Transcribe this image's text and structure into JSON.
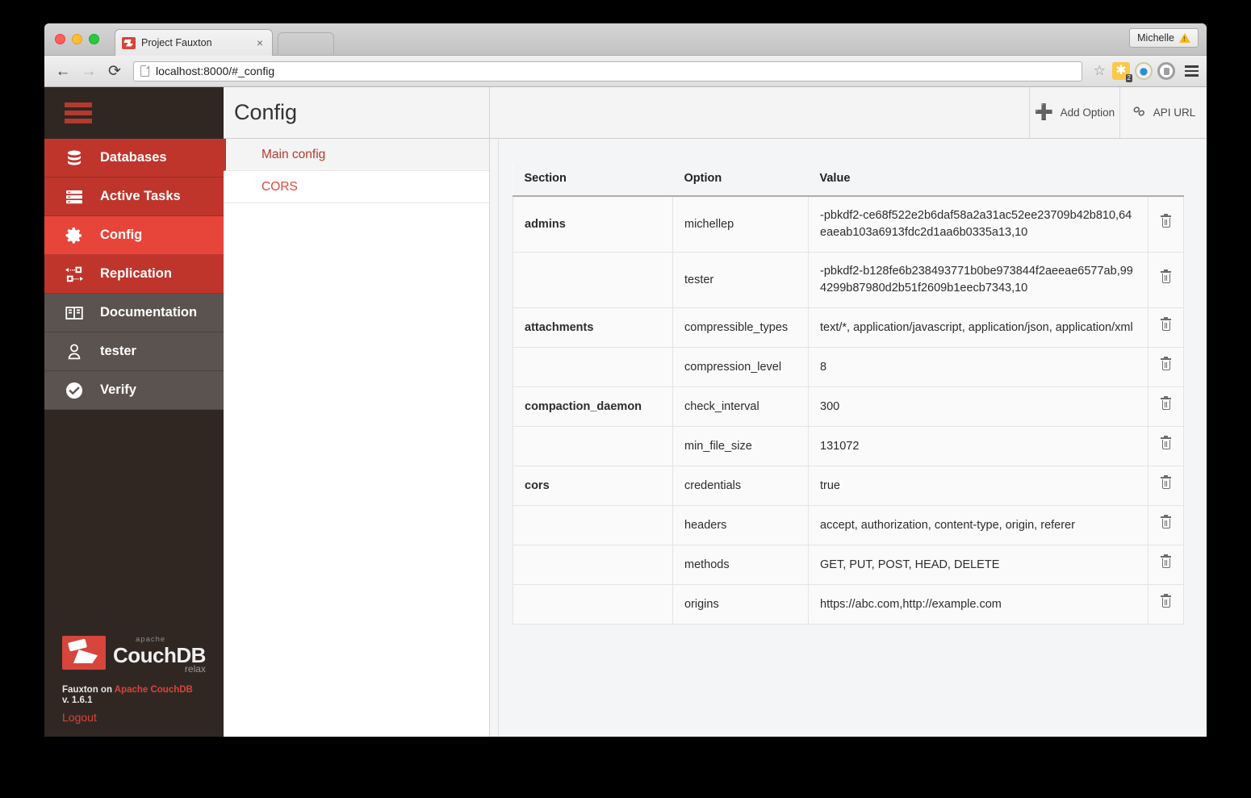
{
  "browser": {
    "tab_title": "Project Fauxton",
    "tab_close_label": "×",
    "url": "localhost:8000/#_config",
    "back_label": "←",
    "forward_label": "→",
    "reload_label": "⟳",
    "star_label": "☆",
    "user_chip_label": "Michelle",
    "extension_badge": "2",
    "spark_label": "✱"
  },
  "sidebar": {
    "items": [
      {
        "label": "Databases",
        "icon": "database-icon",
        "state": "red"
      },
      {
        "label": "Active Tasks",
        "icon": "tasks-icon",
        "state": "red"
      },
      {
        "label": "Config",
        "icon": "gear-icon",
        "state": "active"
      },
      {
        "label": "Replication",
        "icon": "replication-icon",
        "state": "red"
      },
      {
        "label": "Documentation",
        "icon": "book-icon",
        "state": "grey"
      },
      {
        "label": "tester",
        "icon": "user-icon",
        "state": "grey"
      },
      {
        "label": "Verify",
        "icon": "check-circle-icon",
        "state": "grey"
      }
    ],
    "footer": {
      "wordmark_apache": "apache",
      "wordmark_name": "CouchDB",
      "wordmark_relax": "relax",
      "credit_prefix": "Fauxton on ",
      "credit_link": "Apache CouchDB",
      "version": "v. 1.6.1",
      "logout": "Logout"
    }
  },
  "config_panel": {
    "title": "Config",
    "items": [
      {
        "label": "Main config",
        "selected": true
      },
      {
        "label": "CORS",
        "selected": false
      }
    ]
  },
  "main": {
    "actions": [
      {
        "label": "Add Option",
        "icon": "plus-icon"
      },
      {
        "label": "API URL",
        "icon": "link-icon"
      }
    ],
    "table": {
      "columns": [
        "Section",
        "Option",
        "Value"
      ],
      "delete_tooltip": "Delete",
      "rows": [
        {
          "section": "admins",
          "option": "michellep",
          "value": "-pbkdf2-ce68f522e2b6daf58a2a31ac52ee23709b42b810,64eaeab103a6913fdc2d1aa6b0335a13,10"
        },
        {
          "section": "",
          "option": "tester",
          "value": "-pbkdf2-b128fe6b238493771b0be973844f2aeeae6577ab,994299b87980d2b51f2609b1eecb7343,10"
        },
        {
          "section": "attachments",
          "option": "compressible_types",
          "value": "text/*, application/javascript, application/json, application/xml"
        },
        {
          "section": "",
          "option": "compression_level",
          "value": "8"
        },
        {
          "section": "compaction_daemon",
          "option": "check_interval",
          "value": "300"
        },
        {
          "section": "",
          "option": "min_file_size",
          "value": "131072"
        },
        {
          "section": "cors",
          "option": "credentials",
          "value": "true"
        },
        {
          "section": "",
          "option": "headers",
          "value": "accept, authorization, content-type, origin, referer"
        },
        {
          "section": "",
          "option": "methods",
          "value": "GET, PUT, POST, HEAD, DELETE"
        },
        {
          "section": "",
          "option": "origins",
          "value": "https://abc.com,http://example.com"
        }
      ]
    }
  },
  "colors": {
    "brand_red": "#d7453c",
    "nav_red": "#bf352c",
    "nav_active_red": "#e8453a",
    "nav_grey": "#5b5350",
    "nav_dark": "#302723",
    "link_red": "#e0483c"
  }
}
